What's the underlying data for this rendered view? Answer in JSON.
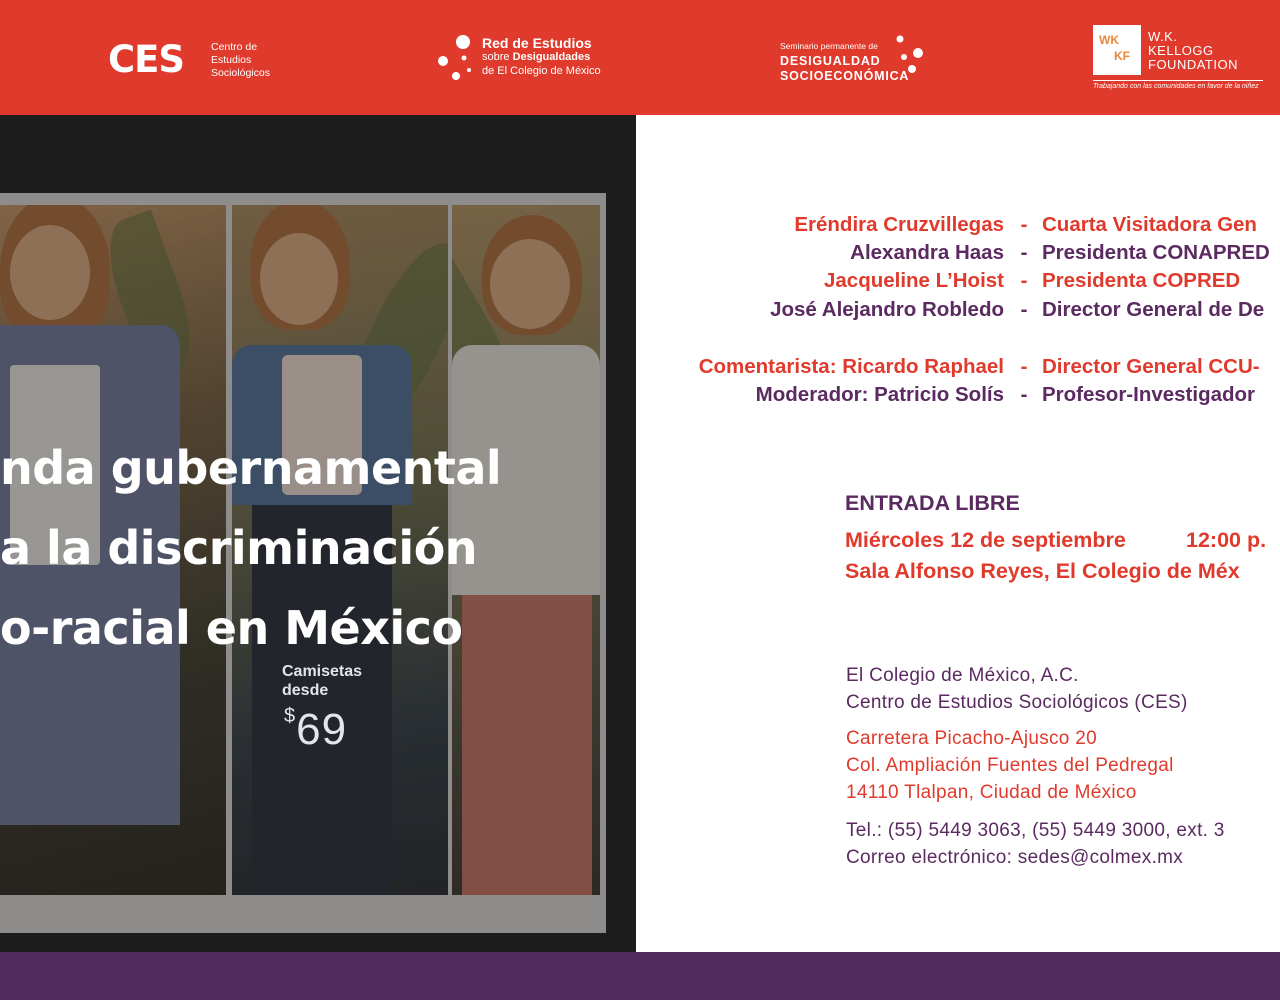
{
  "header": {
    "ces": {
      "mark": "CES",
      "lines": [
        "Centro de",
        "Estudios",
        "Sociológicos"
      ]
    },
    "red": {
      "line1": "Red de Estudios",
      "line2_a": "sobre",
      "line2_b": "Desigualdades",
      "line3": "de El Colegio de México"
    },
    "seminario": {
      "line1": "Seminario permanente de",
      "line2": "DESIGUALDAD",
      "line3": "SOCIOECONÓMICA"
    },
    "kellogg": {
      "box_w": "WK",
      "box_k": "KF",
      "line1": "W.K.",
      "line2": "KELLOGG",
      "line3": "FOUNDATION",
      "tagline": "Trabajando con las comunidades en favor de la niñez"
    }
  },
  "photo": {
    "sign_line1": "Camisetas",
    "sign_line2": "desde",
    "sign_price": "69",
    "sign_currency": "$",
    "title_line1": "nda gubernamental",
    "title_line2": "a la discriminación",
    "title_line3": "o-racial en México"
  },
  "panelists": [
    {
      "name": "Eréndira Cruzvillegas",
      "dash": "-",
      "role": "Cuarta Visitadora Gen",
      "color": "red"
    },
    {
      "name": "Alexandra Haas",
      "dash": "-",
      "role": "Presidenta CONAPRED",
      "color": "purple"
    },
    {
      "name": "Jacqueline L’Hoist",
      "dash": "-",
      "role": "Presidenta COPRED",
      "color": "red"
    },
    {
      "name": "José Alejandro Robledo",
      "dash": "-",
      "role": "Director General de De",
      "color": "purple"
    },
    {
      "name": "Comentarista: Ricardo Raphael",
      "dash": "-",
      "role": "Director General CCU-",
      "color": "red"
    },
    {
      "name": "Moderador: Patricio Solís",
      "dash": "-",
      "role": "Profesor-Investigador",
      "color": "purple"
    }
  ],
  "event": {
    "entry": "ENTRADA LIBRE",
    "date": "Miércoles 12 de septiembre",
    "time": "12:00 p.",
    "venue": "Sala Alfonso Reyes, El Colegio de Méx"
  },
  "address": {
    "institution": "El Colegio de México, A.C.",
    "center": "Centro de Estudios Sociológicos (CES)",
    "street": "Carretera Picacho-Ajusco 20",
    "colony": "Col. Ampliación Fuentes del Pedregal",
    "city": "14110 Tlalpan, Ciudad de México",
    "phone": "Tel.: (55) 5449 3063, (55) 5449 3000, ext. 3",
    "email": "Correo electrónico: sedes@colmex.mx"
  },
  "colors": {
    "header_red": "#e03a2c",
    "accent_purple": "#5a2a60",
    "footer_purple": "#512a5c",
    "kellogg_orange": "#e8873a"
  }
}
